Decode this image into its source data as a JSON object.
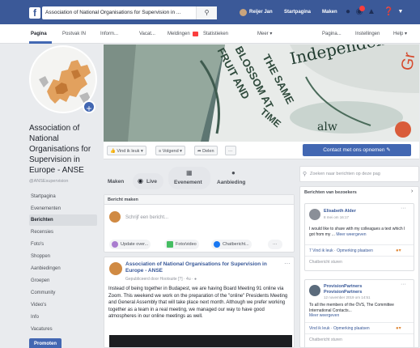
{
  "topbar": {
    "search_text": "Association of National Organisations for Supervision in ...",
    "user_name": "Reijer Jan",
    "nav_home": "Startpagina",
    "nav_create": "Maken"
  },
  "page_tabs": [
    "Pagina",
    "Postvak IN",
    "Inform...",
    "Vacat...",
    "Meldingen",
    "Statistieken",
    "Meer",
    "Pagina...",
    "Instellingen",
    "Help"
  ],
  "page": {
    "name": "Association of National Organisations for Supervision in Europe - ANSE",
    "handle": "@ANSEsupervision"
  },
  "left_nav": [
    "Startpagina",
    "Evenementen",
    "Berichten",
    "Recensies",
    "Foto's",
    "Shoppen",
    "Aanbiedingen",
    "Groepen",
    "Community",
    "Video's",
    "Info",
    "Vacatures"
  ],
  "left_nav_active": "Berichten",
  "promote_label": "Promoten",
  "cover_words": [
    "FRUIT AND",
    "BLOSSOM AT",
    "THE SAME",
    "TIME",
    "Independence",
    "alw",
    "Gr"
  ],
  "action_bar": {
    "like": "Vind ik leuk",
    "follow": "Volgend",
    "share": "Delen",
    "more": "···",
    "contact": "Contact met ons opnemen"
  },
  "composer_tabs": [
    "Maken",
    "Live",
    "Evenement",
    "Aanbieding"
  ],
  "composer": {
    "header": "Bericht maken",
    "placeholder": "Schrijf een bericht...",
    "actions": [
      "Update over...",
      "Foto/video",
      "Chatbericht..."
    ],
    "more": "···"
  },
  "post": {
    "author": "Association of National Organisations for Supervision in Europe - ANSE",
    "meta": "Gepubliceerd door Hootsuite [?] · 4u · ",
    "text": "Instead of being together in Budapest, we are having Board Meeting 91 online via Zoom. This weekend we work on the preparation of the \"online\" Presidents Meeting and General Assembly that will take place next month. Although we prefer working together as a team in a real meeting, we managed our way to have good atmospheres in our online meetings as well."
  },
  "right": {
    "search_placeholder": "Zoeken naar berichten op deze pag",
    "visitors_title": "Berichten van bezoekers",
    "cards": [
      {
        "name": "Elisabeth Alder",
        "date": "8 mei om 16:17",
        "text": "I would like to share with my colleagues a text which I got from my ...",
        "more": "Meer weergeven",
        "like": "7 Vind ik leuk",
        "comment": "Opmerking plaatsen",
        "send": "Chatbericht sturen"
      },
      {
        "name": "ProvisionPartners ProvisionPartners",
        "date": "12 november 2019 om 14:51",
        "text": "To all the members of the ÖVS, The Committee International Contacts...",
        "more": "Meer weergeven",
        "like": "Vind ik leuk",
        "comment": "Opmerking plaatsen",
        "send": "Chatbericht sturen"
      }
    ]
  },
  "colors": {
    "facebook_blue": "#3b5998",
    "button_blue": "#4267b2",
    "link_blue": "#385898",
    "background": "#e9ebee"
  }
}
